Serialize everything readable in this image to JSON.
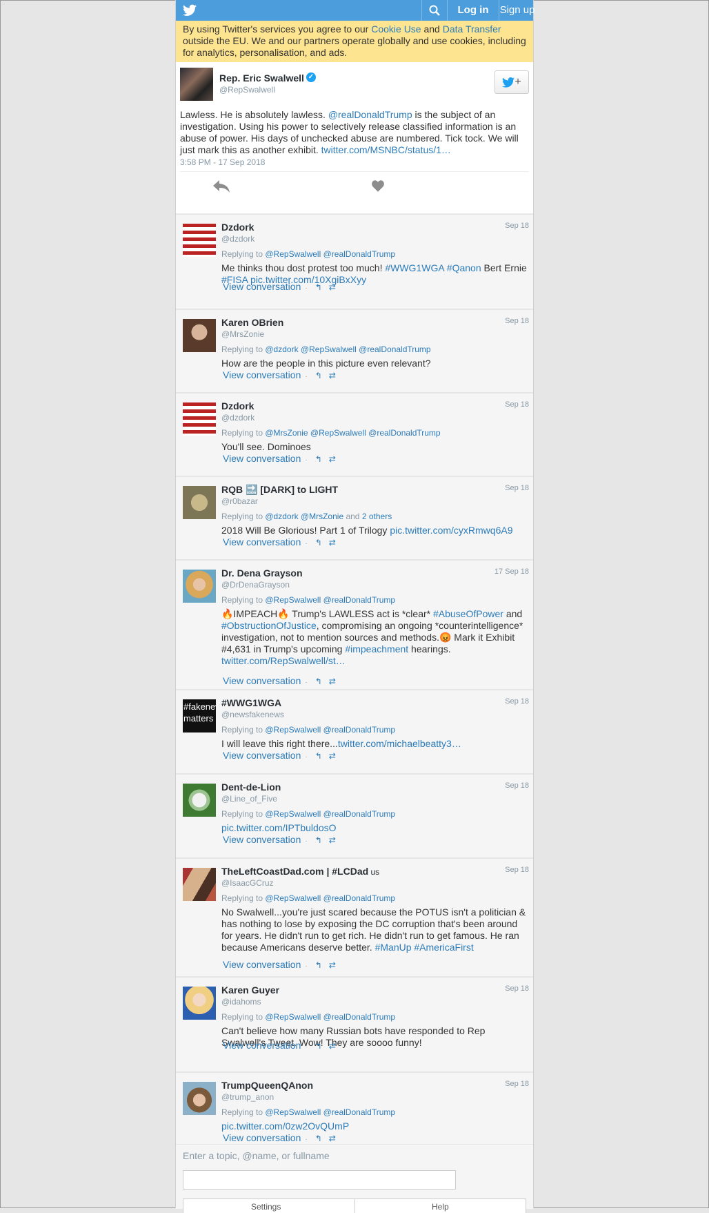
{
  "header": {
    "login": "Log in",
    "signup": "Sign up"
  },
  "cookie": {
    "pre": "By using Twitter's services you agree to our ",
    "link1": "Cookie Use",
    "mid": " and ",
    "link2": "Data Transfer",
    "post": " outside the EU. We and our partners operate globally and use cookies, including for analytics, personalisation, and ads."
  },
  "tweet": {
    "name": "Rep. Eric Swalwell",
    "handle": "@RepSwalwell",
    "text_a": "Lawless. He is absolutely lawless. ",
    "mention": "@realDonaldTrump",
    "text_b": " is the subject of an investigation. Using his power to selectively release classified information is an abuse of power. His days of unchecked abuse are numbered. Tick tock. We will just mark this as another exhibit. ",
    "link": "twitter.com/MSNBC/status/1…",
    "time": "3:58 PM - 17 Sep 2018"
  },
  "replies": [
    {
      "name": "Dzdork",
      "handle": "@dzdork",
      "date": "Sep 18",
      "to": [
        "@RepSwalwell",
        "@realDonaldTrump"
      ],
      "text": [
        [
          "t",
          "Me thinks thou dost protest too much! "
        ],
        [
          "l",
          "#WWG1WGA"
        ],
        [
          "t",
          " "
        ],
        [
          "l",
          "#Qanon"
        ],
        [
          "t",
          " Bert Ernie "
        ],
        [
          "l",
          "#FISA"
        ],
        [
          "t",
          " "
        ],
        [
          "l",
          "pic.twitter.com/10XgiBxXyy"
        ]
      ],
      "avatar": "flag"
    },
    {
      "name": "Karen OBrien",
      "handle": "@MrsZonie",
      "date": "Sep 18",
      "to": [
        "@dzdork",
        "@RepSwalwell",
        "@realDonaldTrump"
      ],
      "text": [
        [
          "t",
          "How are the people in this picture even relevant?"
        ]
      ],
      "avatar": "woman"
    },
    {
      "name": "Dzdork",
      "handle": "@dzdork",
      "date": "Sep 18",
      "to": [
        "@MrsZonie",
        "@RepSwalwell",
        "@realDonaldTrump"
      ],
      "text": [
        [
          "t",
          "You'll see. Dominoes"
        ]
      ],
      "avatar": "flag"
    },
    {
      "name": "RQB 🔜 [DARK] to LIGHT",
      "handle": "@r0bazar",
      "date": "Sep 18",
      "to": [
        "@dzdork",
        "@MrsZonie"
      ],
      "to_more": "2 others",
      "and": " and ",
      "text": [
        [
          "t",
          "2018 Will Be Glorious! Part 1 of Trilogy "
        ],
        [
          "l",
          "pic.twitter.com/cyxRmwq6A9"
        ]
      ],
      "avatar": "money"
    },
    {
      "name": "Dr. Dena Grayson",
      "handle": "@DrDenaGrayson",
      "date": "17 Sep 18",
      "to": [
        "@RepSwalwell",
        "@realDonaldTrump"
      ],
      "text": [
        [
          "t",
          "🔥IMPEACH🔥 Trump's LAWLESS act is *clear* "
        ],
        [
          "l",
          "#AbuseOfPower"
        ],
        [
          "t",
          " and "
        ],
        [
          "l",
          "#ObstructionOfJustice"
        ],
        [
          "t",
          ", compromising an ongoing *counterintelligence* investigation, not to mention sources and methods.😡 Mark it Exhibit #4,631 in Trump's upcoming "
        ],
        [
          "l",
          "#impeachment"
        ],
        [
          "t",
          " hearings. "
        ],
        [
          "l",
          "twitter.com/RepSwalwell/st…"
        ]
      ],
      "avatar": "blonde"
    },
    {
      "name": "#WWG1WGA",
      "handle": "@newsfakenews",
      "date": "Sep 18",
      "to": [
        "@RepSwalwell",
        "@realDonaldTrump"
      ],
      "text": [
        [
          "t",
          "I will leave this right there..."
        ],
        [
          "l",
          "twitter.com/michaelbeatty3…"
        ]
      ],
      "avatar": "fakenews",
      "avatar_text": "#fakenews matters"
    },
    {
      "name": "Dent-de-Lion",
      "handle": "@Line_of_Five",
      "date": "Sep 18",
      "to": [
        "@RepSwalwell",
        "@realDonaldTrump"
      ],
      "text": [
        [
          "l",
          "pic.twitter.com/IPTbuldosO"
        ]
      ],
      "avatar": "dandelion"
    },
    {
      "name": "TheLeftCoastDad.com | #LCDad",
      "name_suffix": " us",
      "handle": "@IsaacGCruz",
      "date": "Sep 18",
      "to": [
        "@RepSwalwell",
        "@realDonaldTrump"
      ],
      "text": [
        [
          "t",
          "No Swalwell...you're just scared because the POTUS isn't a politician & has nothing to lose by exposing the DC corruption that's been around for years. He didn't run to get rich. He didn't run to get famous. He ran because Americans deserve better. "
        ],
        [
          "l",
          "#ManUp"
        ],
        [
          "t",
          " "
        ],
        [
          "l",
          "#AmericaFirst"
        ]
      ],
      "avatar": "family"
    },
    {
      "name": "Karen Guyer",
      "handle": "@idahoms",
      "date": "Sep 18",
      "to": [
        "@RepSwalwell",
        "@realDonaldTrump"
      ],
      "text": [
        [
          "t",
          "Can't believe how many Russian bots have responded to Rep Swalwell's Tweet. Wow! They are soooo funny!"
        ]
      ],
      "avatar": "blonde2"
    },
    {
      "name": "TrumpQueenQAnon",
      "handle": "@trump_anon",
      "date": "Sep 18",
      "to": [
        "@RepSwalwell",
        "@realDonaldTrump"
      ],
      "text": [
        [
          "l",
          "pic.twitter.com/0zw2OvQUmP"
        ]
      ],
      "avatar": "queen"
    }
  ],
  "labels": {
    "replying": "Replying to ",
    "view": "View conversation",
    "dot": "·"
  },
  "footer": {
    "hint": "Enter a topic, @name, or fullname",
    "tab1": "Settings",
    "tab2": "Help"
  },
  "colors": {
    "bar": "#4b9ddc",
    "link": "#2b7bb9",
    "cookie_bg": "#fde490"
  }
}
